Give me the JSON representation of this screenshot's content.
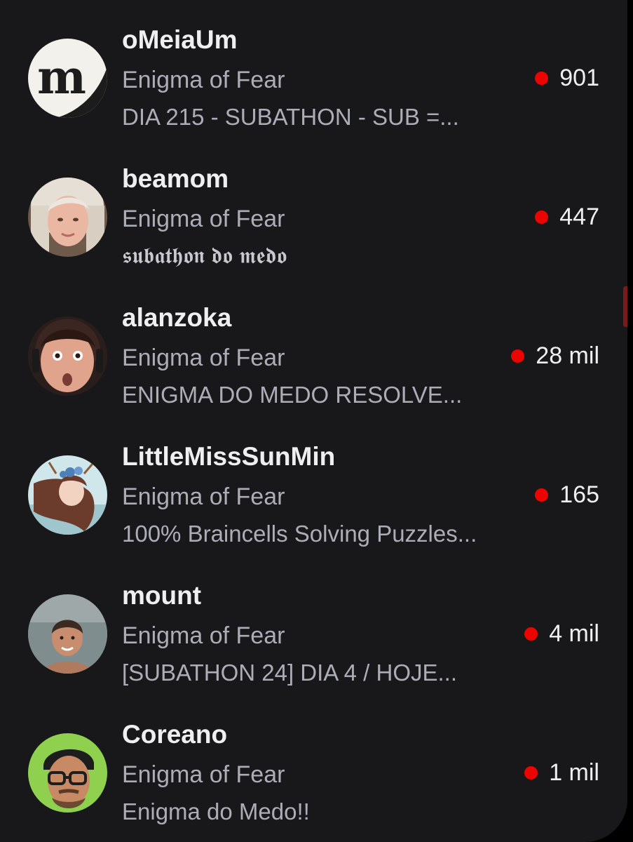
{
  "streams": [
    {
      "channel": "oMeiaUm",
      "game": "Enigma of Fear",
      "title": "DIA 215 - SUBATHON - SUB =...",
      "viewers": "901",
      "avatar_icon": "m-logo-avatar",
      "avatar_letter": "m"
    },
    {
      "channel": "beamom",
      "game": "Enigma of Fear",
      "title": "𝖘𝖚𝖇𝖆𝖙𝖍𝖔𝖓 𝖉𝖔 𝖒𝖊𝖉𝖔",
      "viewers": "447",
      "avatar_icon": "profile-photo-avatar"
    },
    {
      "channel": "alanzoka",
      "game": "Enigma of Fear",
      "title": "ENIGMA DO MEDO RESOLVE...",
      "viewers": "28 mil",
      "avatar_icon": "profile-photo-avatar"
    },
    {
      "channel": "LittleMissSunMin",
      "game": "Enigma of Fear",
      "title": "100% Braincells Solving Puzzles...",
      "viewers": "165",
      "avatar_icon": "illustrated-avatar"
    },
    {
      "channel": "mount",
      "game": "Enigma of Fear",
      "title": "[SUBATHON 24] DIA 4 / HOJE...",
      "viewers": "4 mil",
      "avatar_icon": "profile-photo-avatar"
    },
    {
      "channel": "Coreano",
      "game": "Enigma of Fear",
      "title": "Enigma do Medo!!",
      "viewers": "1 mil",
      "avatar_icon": "cartoon-avatar"
    }
  ],
  "colors": {
    "background": "#18181b",
    "name_text": "#efeff1",
    "meta_text": "#adadb8",
    "live_dot": "#eb0400"
  }
}
